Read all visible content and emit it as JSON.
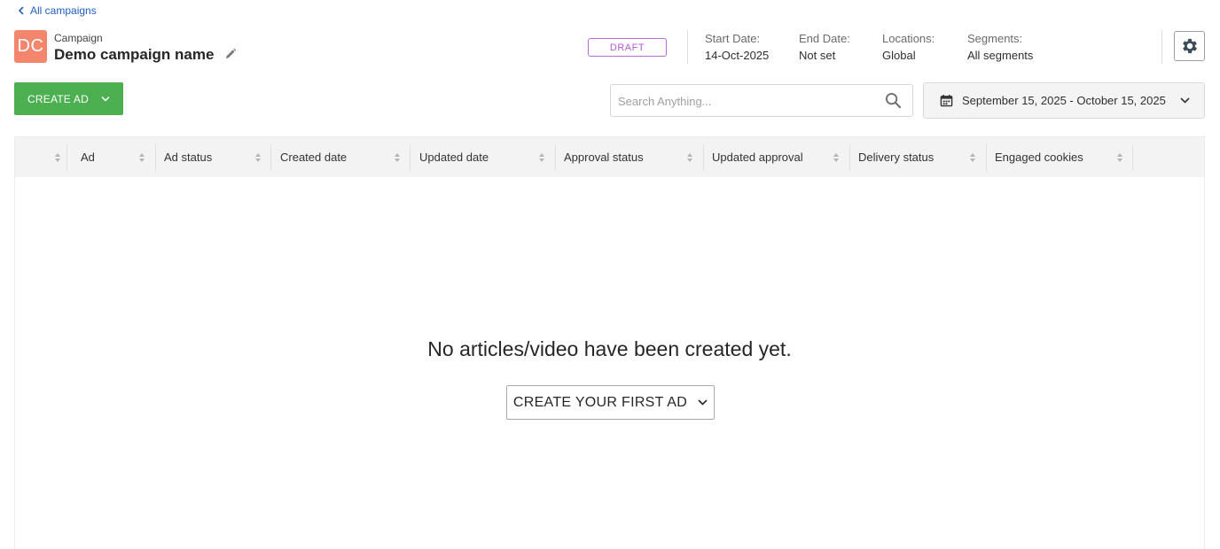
{
  "nav": {
    "back_label": "All campaigns"
  },
  "campaign": {
    "initials": "DC",
    "caption": "Campaign",
    "name": "Demo campaign name",
    "status": "DRAFT",
    "avatar_color": "#f4866e"
  },
  "meta": {
    "start_label": "Start Date:",
    "start_value": "14-Oct-2025",
    "end_label": "End Date:",
    "end_value": "Not set",
    "locations_label": "Locations:",
    "locations_value": "Global",
    "segments_label": "Segments:",
    "segments_value": "All segments"
  },
  "toolbar": {
    "create_ad_label": "CREATE AD",
    "search_placeholder": "Search Anything...",
    "search_value": "",
    "date_range": "September 15, 2025 - October 15, 2025"
  },
  "table": {
    "columns": [
      "Ad",
      "Ad status",
      "Created date",
      "Updated date",
      "Approval status",
      "Updated approval",
      "Delivery status",
      "Engaged cookies"
    ]
  },
  "empty_state": {
    "message": "No articles/video have been created yet.",
    "button_label": "CREATE YOUR FIRST AD"
  },
  "colors": {
    "primary_green": "#4caf50",
    "link_blue": "#1f5fbf",
    "draft_purple": "#b05ad0"
  },
  "icons": [
    "chevron-left-icon",
    "pencil-icon",
    "gear-icon",
    "chevron-down-icon",
    "search-icon",
    "calendar-icon",
    "sort-icon"
  ]
}
